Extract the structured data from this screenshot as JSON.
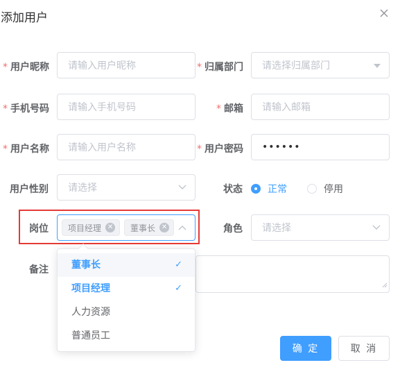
{
  "dialog": {
    "title": "添加用户",
    "close_icon": "close-icon"
  },
  "form": {
    "nickname": {
      "label": "用户昵称",
      "required": "*",
      "placeholder": "请输入用户昵称"
    },
    "dept": {
      "label": "归属部门",
      "required": "*",
      "placeholder": "请选择归属部门"
    },
    "phone": {
      "label": "手机号码",
      "required": "*",
      "placeholder": "请输入手机号码"
    },
    "email": {
      "label": "邮箱",
      "required": "*",
      "placeholder": "请输入邮箱"
    },
    "username": {
      "label": "用户名称",
      "required": "*",
      "placeholder": "请输入用户名称"
    },
    "password": {
      "label": "用户密码",
      "required": "*",
      "value": "••••••"
    },
    "gender": {
      "label": "用户性别",
      "placeholder": "请选择"
    },
    "status": {
      "label": "状态",
      "options": [
        "正常",
        "停用"
      ],
      "selected": "正常"
    },
    "post": {
      "label": "岗位",
      "tags": [
        "项目经理",
        "董事长"
      ]
    },
    "role": {
      "label": "角色",
      "placeholder": "请选择"
    },
    "remark": {
      "label": "备注"
    }
  },
  "post_dropdown": {
    "options": [
      {
        "label": "董事长",
        "selected": true
      },
      {
        "label": "项目经理",
        "selected": true
      },
      {
        "label": "人力资源",
        "selected": false
      },
      {
        "label": "普通员工",
        "selected": false
      }
    ],
    "check_mark": "✓"
  },
  "buttons": {
    "confirm": "确 定",
    "cancel": "取 消"
  },
  "colors": {
    "primary": "#409eff",
    "required": "#f56c6c",
    "highlight": "#e53935"
  }
}
